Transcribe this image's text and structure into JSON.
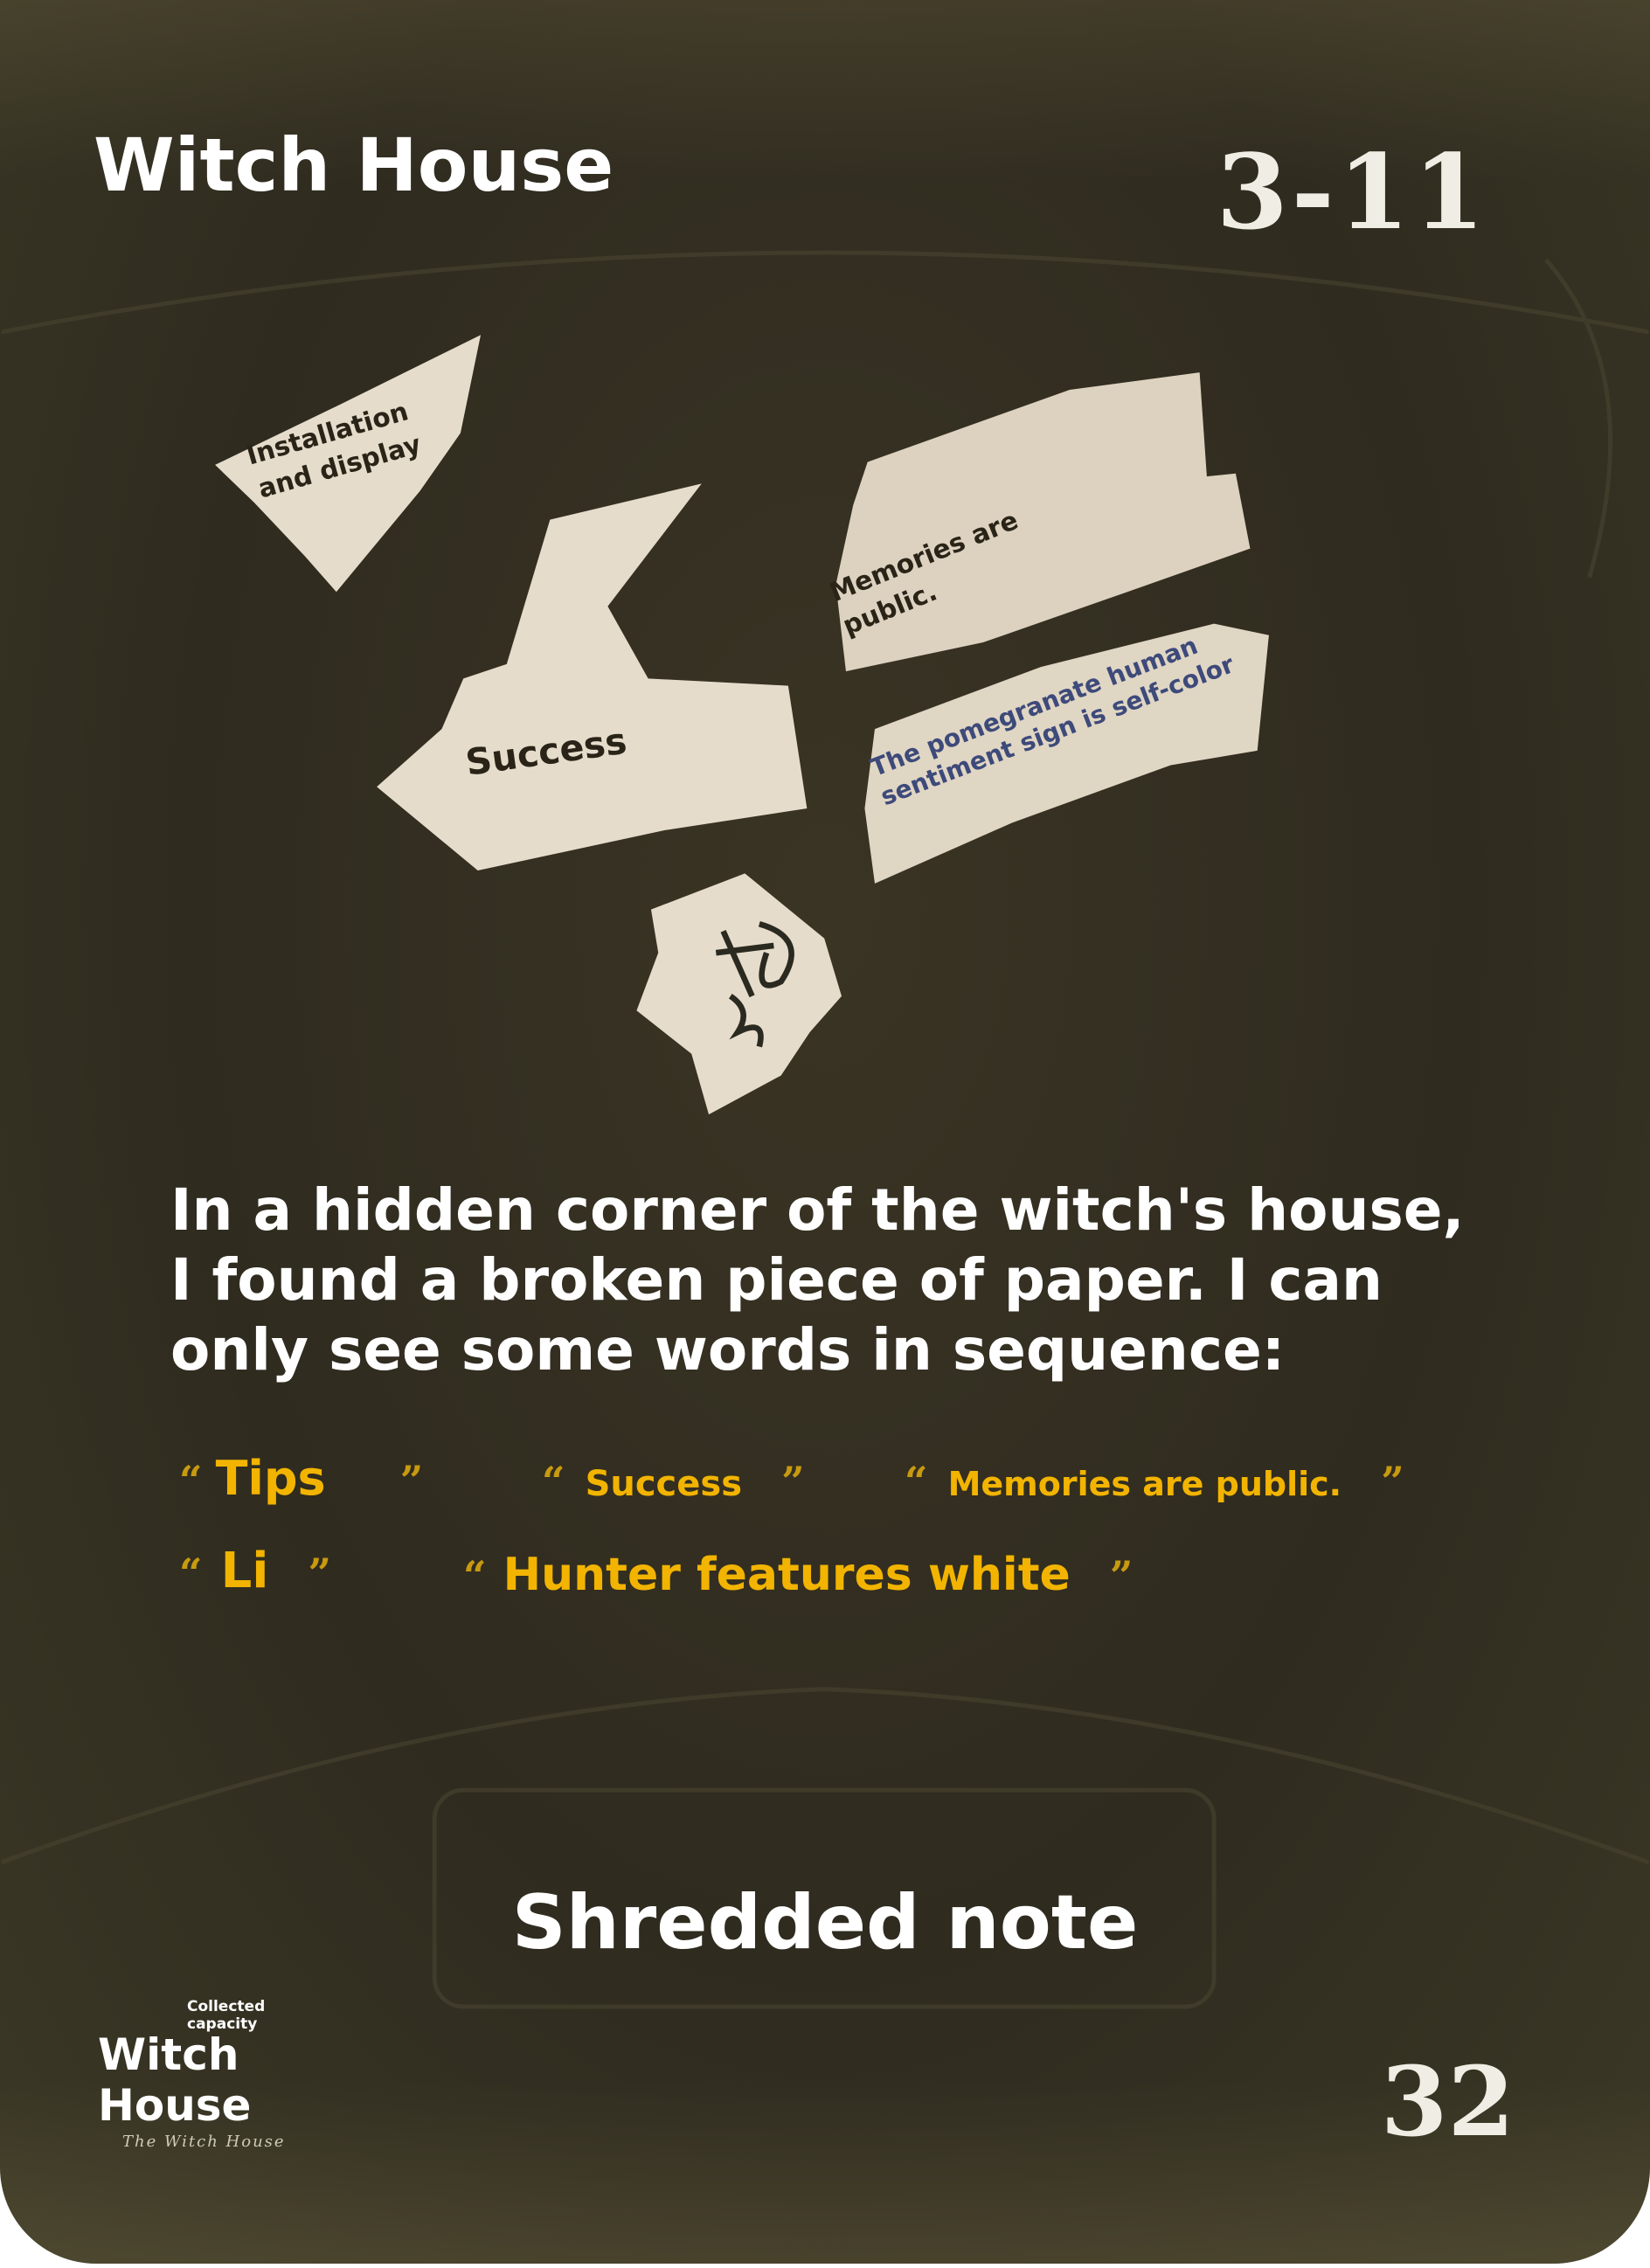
{
  "card": {
    "title": "Witch House",
    "code": "3-11",
    "fragments": [
      "Installation and display",
      "Success",
      "Memories are public.",
      "The pomegranate human sentiment sign is self-color"
    ],
    "fragment_lines": {
      "installation": [
        "Installation",
        "and display"
      ],
      "memories": [
        "Memories are",
        "public."
      ],
      "pomegranate": [
        "The pomegranate human",
        "sentiment sign is self-color"
      ]
    },
    "story": "In a hidden corner of the witch's house, I found a broken piece of paper. I can only see some words in sequence:",
    "quotes_row1": [
      "Tips",
      "Success",
      "Memories are public."
    ],
    "quotes_row2": [
      "Li",
      "Hunter features white"
    ],
    "open_quote": "“",
    "close_quote": "”",
    "card_name": "Shredded note",
    "number": "32",
    "logo": {
      "tag": "Collected capacity",
      "line1": "Witch",
      "line2": "House",
      "sub": "The Witch House"
    },
    "colors": {
      "accent": "#f2b400",
      "background": "#2f2b1f",
      "paper": "#e6dccb"
    }
  }
}
